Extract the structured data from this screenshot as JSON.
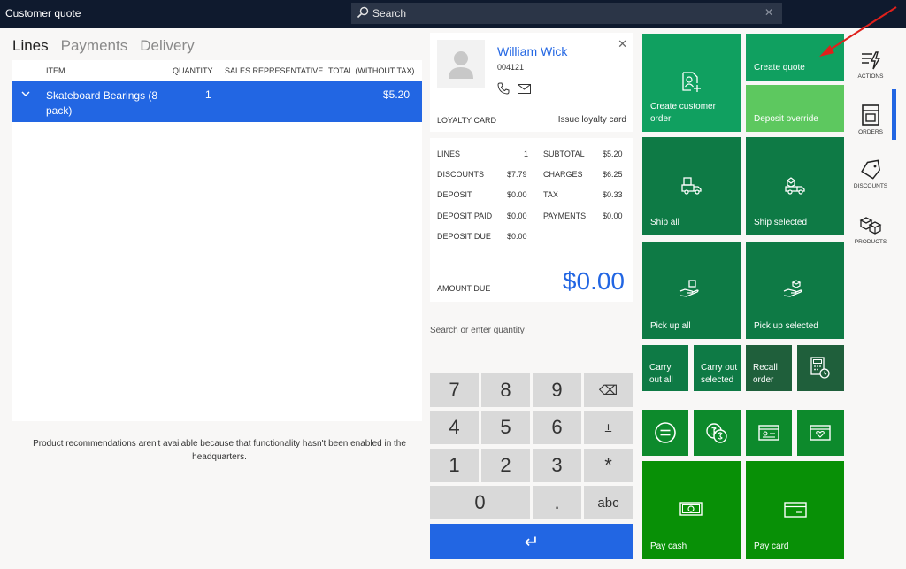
{
  "app": {
    "title": "Customer quote"
  },
  "search": {
    "placeholder": "Search",
    "clear": "✕"
  },
  "tabs": [
    {
      "label": "Lines"
    },
    {
      "label": "Payments"
    },
    {
      "label": "Delivery"
    }
  ],
  "lines_table": {
    "columns": [
      "ITEM",
      "QUANTITY",
      "SALES REPRESENTATIVE",
      "TOTAL (WITHOUT TAX)"
    ],
    "rows": [
      {
        "item": "Skateboard Bearings (8 pack)",
        "quantity": "1",
        "sales_rep": "",
        "total": "$5.20"
      }
    ]
  },
  "recommendations_message": "Product recommendations aren't available because that functionality hasn't been enabled in the headquarters.",
  "customer": {
    "name": "William Wick",
    "id": "004121",
    "loyalty_label": "LOYALTY CARD",
    "loyalty_link": "Issue loyalty card",
    "close": "✕"
  },
  "totals": {
    "lines_label": "LINES",
    "lines_value": "1",
    "discounts_label": "DISCOUNTS",
    "discounts_value": "$7.79",
    "deposit_label": "DEPOSIT",
    "deposit_value": "$0.00",
    "deposit_paid_label": "DEPOSIT PAID",
    "deposit_paid_value": "$0.00",
    "deposit_due_label": "DEPOSIT DUE",
    "deposit_due_value": "$0.00",
    "subtotal_label": "SUBTOTAL",
    "subtotal_value": "$5.20",
    "charges_label": "CHARGES",
    "charges_value": "$6.25",
    "tax_label": "TAX",
    "tax_value": "$0.33",
    "payments_label": "PAYMENTS",
    "payments_value": "$0.00",
    "amount_due_label": "AMOUNT DUE",
    "amount_due_value": "$0.00"
  },
  "quantity_search": {
    "placeholder": "Search or enter quantity"
  },
  "keypad": {
    "k7": "7",
    "k8": "8",
    "k9": "9",
    "backspace": "⌫",
    "k4": "4",
    "k5": "5",
    "k6": "6",
    "plusminus": "±",
    "k1": "1",
    "k2": "2",
    "k3": "3",
    "multiply": "*",
    "k0": "0",
    "dot": ".",
    "abc": "abc",
    "enter": "↵"
  },
  "tiles": {
    "create_customer_order": "Create customer order",
    "create_quote": "Create quote",
    "deposit_override": "Deposit override",
    "ship_all": "Ship all",
    "ship_selected": "Ship selected",
    "pick_up_all": "Pick up all",
    "pick_up_selected": "Pick up selected",
    "carry_out_all": "Carry out all",
    "carry_out_selected": "Carry out selected",
    "recall_order": "Recall order",
    "pay_cash": "Pay cash",
    "pay_card": "Pay card"
  },
  "rail": {
    "actions": "ACTIONS",
    "orders": "ORDERS",
    "discounts": "DISCOUNTS",
    "products": "PRODUCTS"
  },
  "colors": {
    "topbar": "#0f1a2e",
    "accent": "#2266e3",
    "tile_green": "#10a060",
    "tile_dark_green": "#0e7a45",
    "tile_light_green": "#5dc85f",
    "tile_payment_green": "#089006"
  }
}
